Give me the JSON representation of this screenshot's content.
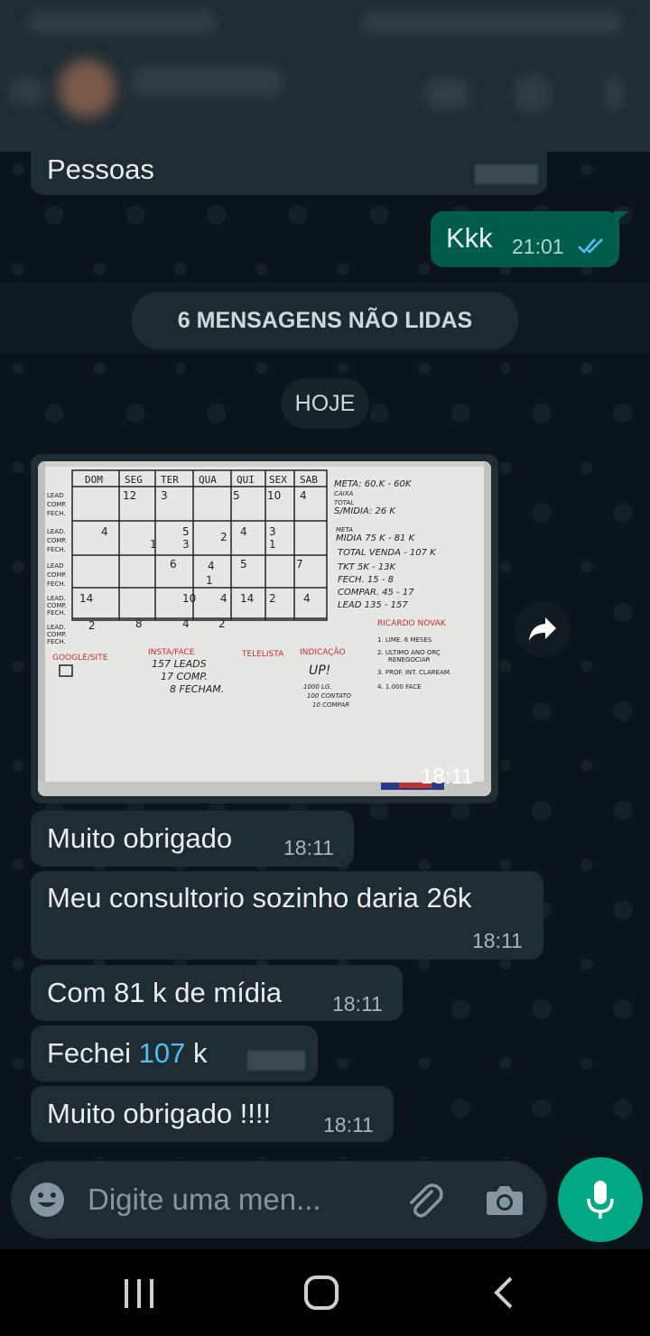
{
  "messages": {
    "prev_text": "Pessoas",
    "kkk_text": "Kkk",
    "kkk_time": "21:01",
    "unread_label": "6 MENSAGENS NÃO LIDAS",
    "day_label": "HOJE",
    "image_time": "18:11",
    "m1_text": "Muito obrigado",
    "m1_time": "18:11",
    "m2_text": "Meu consultorio sozinho daria 26k",
    "m2_time": "18:11",
    "m3_text": "Com 81 k de mídia",
    "m3_time": "18:11",
    "m4_prefix": "Fechei ",
    "m4_link": "107",
    "m4_suffix": " k",
    "m5_text": "Muito obrigado !!!!",
    "m5_time": "18:11"
  },
  "whiteboard": {
    "days": [
      "DOM",
      "SEG",
      "TER",
      "QUA",
      "QUI",
      "SEX",
      "SAB"
    ],
    "row_labels": [
      "LEAD\nCOMP.\nFECH.",
      "LEAD.\nCOMP.\nFECH.",
      "LEAD\nCOMP.\nFECH.",
      "LEAD.\nCOMP.\nFECH.",
      "LEAD.\nCOMP.\nFECH."
    ],
    "right_notes": [
      "META: 60.K - 60K",
      "CAIXA",
      "TOTAL",
      "S/MIDIA: 26 K",
      "META",
      "MIDIA 75 K - 81 K",
      "TOTAL VENDA - 107 K",
      "TKT  5K - 13K",
      "FECH. 15  - 8",
      "COMPAR. 45  - 17",
      "LEAD 135 - 157"
    ],
    "sections": [
      "GOOGLE/SITE",
      "INSTA/FACE",
      "TELELISTA",
      "INDICAÇÃO"
    ],
    "insta_notes": [
      "157 LEADS",
      "17 COMP.",
      "8 FECHAM."
    ],
    "ind_notes": [
      "UP!",
      "1000 LG.",
      "100 CONTATO",
      "10 COMPAR"
    ],
    "novak_title": "RICARDO NOVAK",
    "novak_list": [
      "1. LIME. 6 MESES",
      "2. ULTIMO ANO ORÇ",
      "RENEGOCIAR",
      "3. PROF. INT. CLAREAM.",
      "4. 1.000 FACE"
    ]
  },
  "input": {
    "placeholder": "Digite uma men..."
  },
  "icons": {
    "emoji": "emoji-icon",
    "attach": "paperclip-icon",
    "camera": "camera-icon",
    "mic": "microphone-icon",
    "forward": "forward-icon"
  },
  "colors": {
    "bg": "#0b141a",
    "bubble_in": "#202c33",
    "bubble_out": "#005c4b",
    "accent": "#00a884",
    "read_ticks": "#53bdeb"
  }
}
